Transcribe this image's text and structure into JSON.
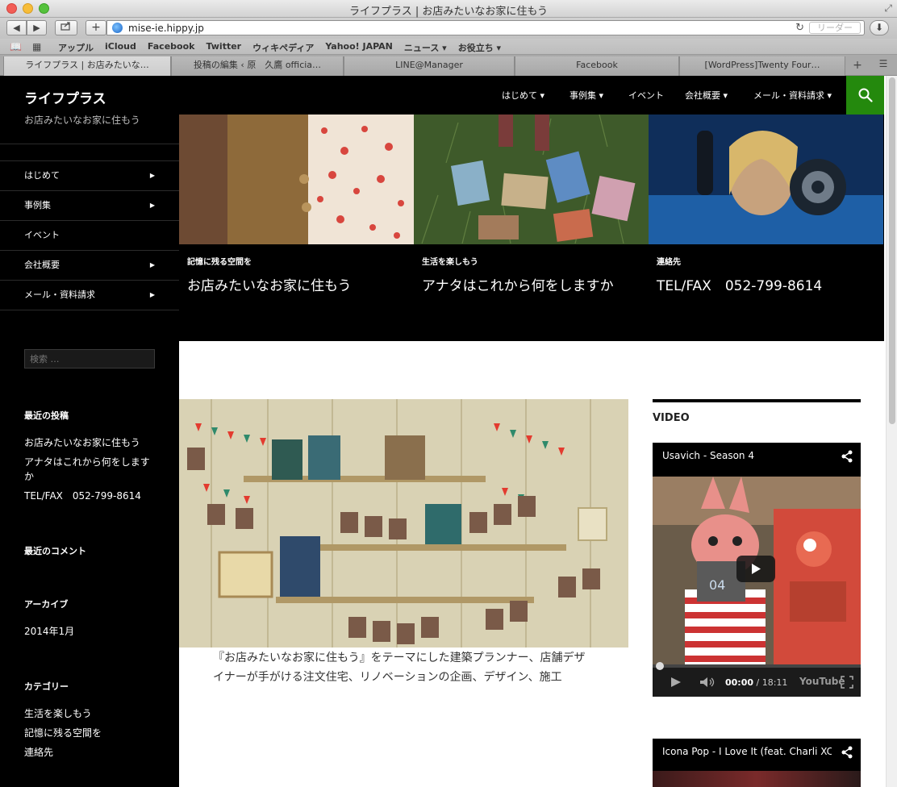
{
  "browser": {
    "window_title": "ライフプラス | お店みたいなお家に住もう",
    "url": "mise-ie.hippy.jp",
    "reader_label": "リーダー",
    "bookmarks": [
      "アップル",
      "iCloud",
      "Facebook",
      "Twitter",
      "ウィキペディア",
      "Yahoo! JAPAN",
      "ニュース ▾",
      "お役立ち ▾"
    ],
    "tabs": [
      {
        "label": "ライフプラス | お店みたいな…",
        "active": true
      },
      {
        "label": "投稿の編集 ‹ 原　久鷹 officia…",
        "active": false
      },
      {
        "label": "LINE@Manager",
        "active": false
      },
      {
        "label": "Facebook",
        "active": false
      },
      {
        "label": "[WordPress]Twenty Four…",
        "active": false
      }
    ]
  },
  "site": {
    "title": "ライフプラス",
    "tagline": "お店みたいなお家に住もう"
  },
  "left_nav": [
    {
      "label": "はじめて",
      "has_children": true
    },
    {
      "label": "事例集",
      "has_children": true
    },
    {
      "label": "イベント",
      "has_children": false
    },
    {
      "label": "会社概要",
      "has_children": true
    },
    {
      "label": "メール・資料請求",
      "has_children": true
    }
  ],
  "search": {
    "placeholder": "検索 …"
  },
  "widgets": {
    "recent_posts_title": "最近の投稿",
    "recent_posts": [
      "お店みたいなお家に住もう",
      "アナタはこれから何をしますか",
      "TEL/FAX　052-799-8614"
    ],
    "recent_comments_title": "最近のコメント",
    "archives_title": "アーカイブ",
    "archives": [
      "2014年1月"
    ],
    "categories_title": "カテゴリー",
    "categories": [
      "生活を楽しもう",
      "記憶に残る空間を",
      "連絡先"
    ]
  },
  "top_nav": [
    {
      "label": "はじめて ▾"
    },
    {
      "label": "事例集 ▾"
    },
    {
      "label": "イベント"
    },
    {
      "label": "会社概要 ▾"
    },
    {
      "label": "メール・資料請求 ▾"
    }
  ],
  "featured": [
    {
      "category": "記憶に残る空間を",
      "title": "お店みたいなお家に住もう"
    },
    {
      "category": "生活を楽しもう",
      "title": "アナタはこれから何をしますか"
    },
    {
      "category": "連絡先",
      "title": "TEL/FAX　052-799-8614"
    }
  ],
  "main": {
    "text": "『お店みたいなお家に住もう』をテーマにした建築プランナー、店舗デザイナーが手がける注文住宅、リノベーションの企画、デザイン、施工"
  },
  "right_sidebar": {
    "video_widget_title": "VIDEO",
    "video1": {
      "title": "Usavich - Season 4",
      "current_time": "00:00",
      "duration": "/ 18:11",
      "progress": 0,
      "logo": "YouTube"
    },
    "video2": {
      "title": "Icona Pop - I Love It (feat. Charli XCX)"
    }
  },
  "colors": {
    "accent": "#24890d",
    "sidebar_bg": "#000000"
  }
}
